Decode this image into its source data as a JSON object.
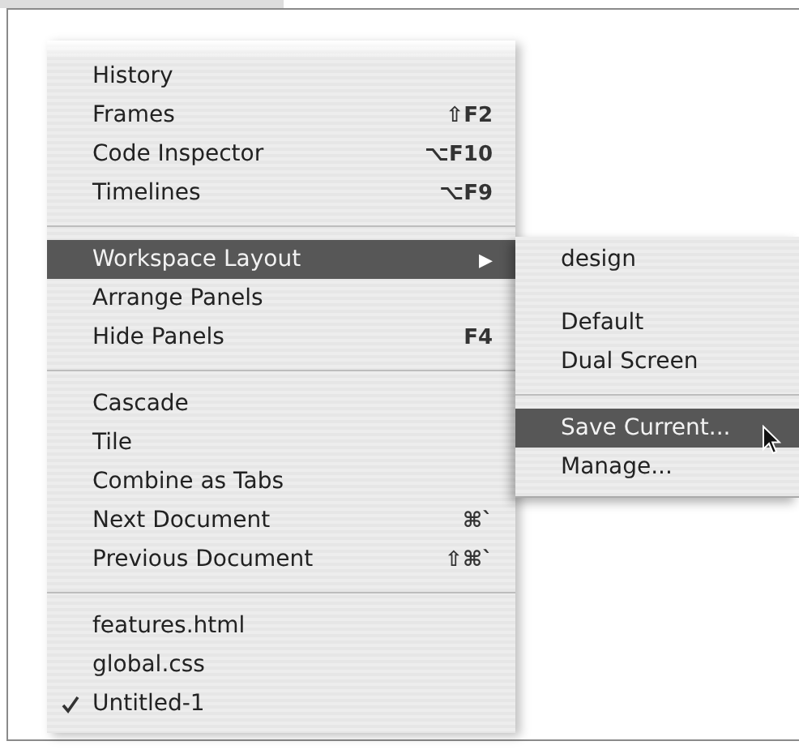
{
  "menu": {
    "sections": [
      [
        {
          "label": "History",
          "selected": false,
          "checked": false
        },
        {
          "label": "Frames",
          "shortcut": "⇧F2",
          "selected": false,
          "checked": false
        },
        {
          "label": "Code Inspector",
          "shortcut": "⌥F10",
          "selected": false,
          "checked": false
        },
        {
          "label": "Timelines",
          "shortcut": "⌥F9",
          "selected": false,
          "checked": false
        }
      ],
      [
        {
          "label": "Workspace Layout",
          "submenu_arrow": "▶",
          "selected": true,
          "checked": false
        },
        {
          "label": "Arrange Panels",
          "selected": false,
          "checked": false
        },
        {
          "label": "Hide Panels",
          "shortcut": "F4",
          "selected": false,
          "checked": false
        }
      ],
      [
        {
          "label": "Cascade",
          "selected": false,
          "checked": false
        },
        {
          "label": "Tile",
          "selected": false,
          "checked": false
        },
        {
          "label": "Combine as Tabs",
          "selected": false,
          "checked": false
        },
        {
          "label": "Next Document",
          "shortcut": "⌘`",
          "selected": false,
          "checked": false
        },
        {
          "label": "Previous Document",
          "shortcut": "⇧⌘`",
          "selected": false,
          "checked": false
        }
      ],
      [
        {
          "label": "features.html",
          "selected": false,
          "checked": false
        },
        {
          "label": "global.css",
          "selected": false,
          "checked": false
        },
        {
          "label": "Untitled-1",
          "selected": false,
          "checked": true
        }
      ]
    ]
  },
  "submenu": {
    "sections": [
      [
        {
          "label": "design",
          "selected": false
        }
      ],
      [
        {
          "label": "Default",
          "selected": false
        },
        {
          "label": "Dual Screen",
          "selected": false
        }
      ],
      [
        {
          "label": "Save Current...",
          "selected": true
        },
        {
          "label": "Manage...",
          "selected": false
        }
      ]
    ]
  }
}
